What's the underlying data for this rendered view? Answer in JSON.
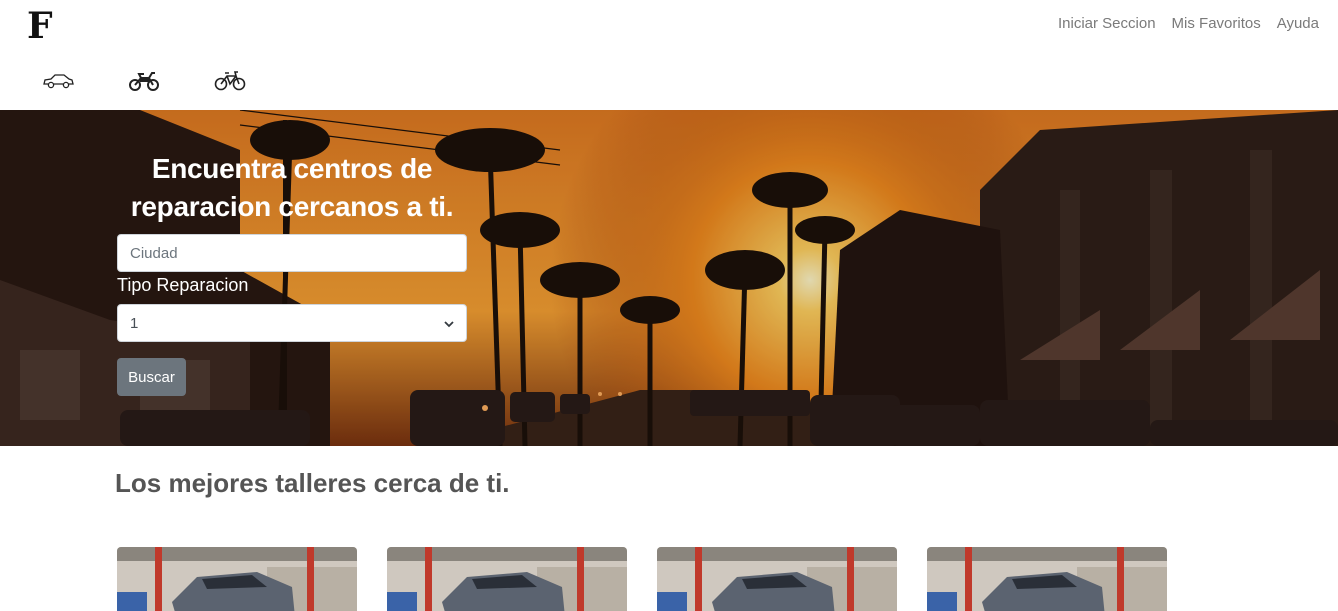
{
  "header": {
    "logo": "F",
    "nav": [
      {
        "label": "Iniciar Seccion"
      },
      {
        "label": "Mis Favoritos"
      },
      {
        "label": "Ayuda"
      }
    ],
    "vehicle_types": [
      {
        "icon": "car-icon"
      },
      {
        "icon": "motorcycle-icon"
      },
      {
        "icon": "bicycle-icon"
      }
    ]
  },
  "hero": {
    "title": "Encuentra centros de reparacion cercanos a ti.",
    "city_placeholder": "Ciudad",
    "repair_type_label": "Tipo Reparacion",
    "repair_type_selected": "1",
    "search_button": "Buscar"
  },
  "section": {
    "title": "Los mejores talleres cerca de ti."
  },
  "cards": [
    {
      "image": "workshop-photo"
    },
    {
      "image": "workshop-photo"
    },
    {
      "image": "workshop-photo"
    },
    {
      "image": "workshop-photo"
    }
  ]
}
